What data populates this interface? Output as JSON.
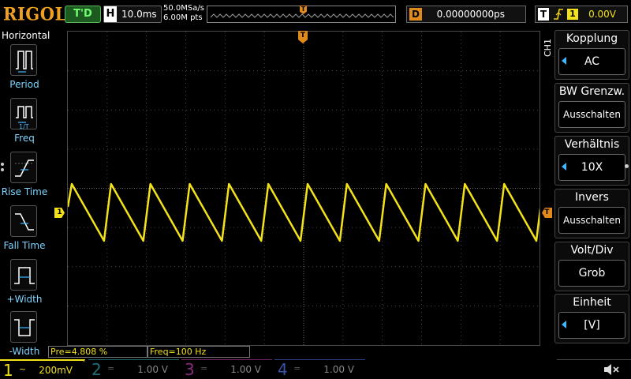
{
  "header": {
    "brand": "RIGOL",
    "run_status": "T'D",
    "timebase_label": "H",
    "timebase_value": "10.0ms",
    "sample_rate": "50.0MSa/s",
    "memory_depth": "6.00M pts",
    "trigger_pos_marker": "T",
    "delay_label": "D",
    "delay_value": "0.00000000ps",
    "trigger_label": "T",
    "trigger_edge": "rising-edge-icon",
    "trigger_source": "1",
    "trigger_level": "0.00V"
  },
  "left_menu": {
    "title": "Horizontal",
    "items": [
      {
        "label": "Period",
        "icon": "period-icon"
      },
      {
        "label": "Freq",
        "icon": "frequency-icon"
      },
      {
        "label": "Rise Time",
        "icon": "rise-time-icon"
      },
      {
        "label": "Fall Time",
        "icon": "fall-time-icon"
      },
      {
        "label": "+Width",
        "icon": "positive-width-icon"
      },
      {
        "label": "-Width",
        "icon": "negative-width-icon"
      }
    ]
  },
  "right_menu": {
    "channel_tag": "CH1",
    "items": [
      {
        "title": "Kopplung",
        "value": "AC"
      },
      {
        "title": "BW Grenzw.",
        "value": "Ausschalten"
      },
      {
        "title": "Verhältnis",
        "value": "10X"
      },
      {
        "title": "Invers",
        "value": "Ausschalten"
      },
      {
        "title": "Volt/Div",
        "value": "Grob"
      },
      {
        "title": "Einheit",
        "value": "[V]"
      }
    ]
  },
  "markers": {
    "ch1": "1",
    "trigger_level": "T"
  },
  "measurements": [
    {
      "text": "Pre=4.808 %"
    },
    {
      "text": "Freq=100 Hz"
    }
  ],
  "channels": [
    {
      "number": "1",
      "coupling": "~",
      "scale": "200mV",
      "color": "#f3e21a"
    },
    {
      "number": "2",
      "coupling": "=",
      "scale": "1.00 V",
      "color": "#1f6f77"
    },
    {
      "number": "3",
      "coupling": "=",
      "scale": "1.00 V",
      "color": "#8a2a7c"
    },
    {
      "number": "4",
      "coupling": "=",
      "scale": "1.00 V",
      "color": "#3852a8"
    }
  ],
  "colors": {
    "ch1": "#f3e21a",
    "trigger": "#e08a1c",
    "menu_accent": "#3fb6ff",
    "label_text": "#7fd4ff"
  },
  "waveform": {
    "type": "sawtooth",
    "cycles": 12,
    "frequency_hz": 100
  }
}
